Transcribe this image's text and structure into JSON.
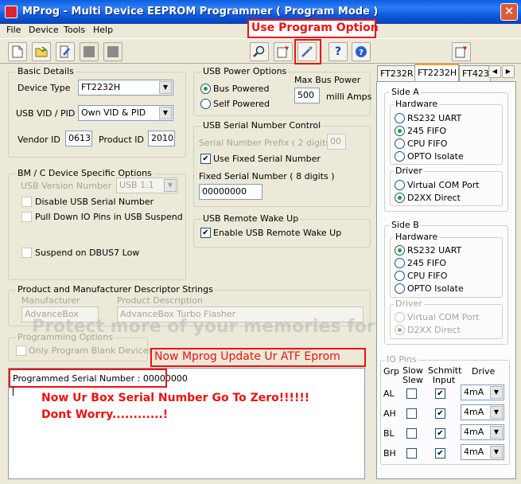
{
  "window": {
    "title": "MProg - Multi Device EEPROM Programmer ( Program Mode )",
    "close": "✕"
  },
  "menu": [
    "File",
    "Device",
    "Tools",
    "Help"
  ],
  "toolbar_icons": [
    "new-icon",
    "open-icon",
    "edit-icon",
    "stop-icon",
    "stop-icon",
    "search-icon",
    "export-icon",
    "program-icon",
    "help-icon",
    "info-icon",
    "export-icon"
  ],
  "annotations": {
    "program_option": "Use Program Option",
    "update_eprom": "Now Mprog Update Ur ATF Eprom",
    "serial_zero_1": "Now Ur Box Serial Number Go To Zero!!!!!!",
    "serial_zero_2": "Dont Worry............!"
  },
  "basic_details": {
    "title": "Basic Details",
    "device_type_label": "Device Type",
    "device_type": "FT2232H",
    "vid_pid_label": "USB VID / PID",
    "vid_pid": "Own VID & PID",
    "vendor_id_label": "Vendor ID",
    "vendor_id": "0613",
    "product_id_label": "Product ID",
    "product_id": "2010"
  },
  "usb_power": {
    "title": "USB Power Options",
    "bus_powered": "Bus Powered",
    "self_powered": "Self Powered",
    "max_bus_power_label": "Max Bus Power",
    "max_bus_power": "500",
    "unit": "milli Amps"
  },
  "bm_options": {
    "title": "BM / C Device Specific Options",
    "usb_version_label": "USB Version Number",
    "usb_version": "USB 1.1",
    "disable_serial": "Disable USB Serial Number",
    "pull_down": "Pull Down IO Pins in USB Suspend",
    "suspend": "Suspend on DBUS7 Low"
  },
  "serial_control": {
    "title": "USB Serial Number Control",
    "prefix_label": "Serial Number Prefix ( 2 digits )",
    "prefix": "00",
    "use_fixed": "Use Fixed Serial Number",
    "fixed_label": "Fixed Serial Number ( 8 digits )",
    "fixed": "00000000"
  },
  "remote_wake": {
    "title": "USB Remote Wake Up",
    "enable": "Enable USB Remote Wake Up"
  },
  "descriptors": {
    "title": "Product and Manufacturer Descriptor Strings",
    "manufacturer_label": "Manufacturer",
    "manufacturer": "AdvanceBox",
    "product_label": "Product Description",
    "product": "AdvanceBox Turbo Flasher"
  },
  "programming": {
    "title": "Programming Options",
    "blank_only": "Only Program Blank Devices"
  },
  "log": {
    "line1": "Programmed Serial Number : 00000000"
  },
  "watermark": "Protect more of your memories for less!",
  "tabs": [
    "FT232R",
    "FT2232H",
    "FT423"
  ],
  "tab_arrows": [
    "◀",
    "▶"
  ],
  "side_a": {
    "title": "Side A",
    "hardware_title": "Hardware",
    "hardware": [
      "RS232 UART",
      "245 FIFO",
      "CPU FIFO",
      "OPTO Isolate"
    ],
    "driver_title": "Driver",
    "driver": [
      "Virtual COM Port",
      "D2XX Direct"
    ]
  },
  "side_b": {
    "title": "Side B",
    "hardware_title": "Hardware",
    "hardware": [
      "RS232 UART",
      "245 FIFO",
      "CPU FIFO",
      "OPTO Isolate"
    ],
    "driver_title": "Driver",
    "driver": [
      "Virtual COM Port",
      "D2XX Direct"
    ]
  },
  "io_pins": {
    "title": "IO Pins",
    "headers": {
      "grp": "Grp",
      "slow_slew": "Slow Slew",
      "schmitt": "Schmitt Input",
      "drive": "Drive"
    },
    "rows": [
      {
        "grp": "AL",
        "drive": "4mA"
      },
      {
        "grp": "AH",
        "drive": "4mA"
      },
      {
        "grp": "BL",
        "drive": "4mA"
      },
      {
        "grp": "BH",
        "drive": "4mA"
      }
    ]
  }
}
